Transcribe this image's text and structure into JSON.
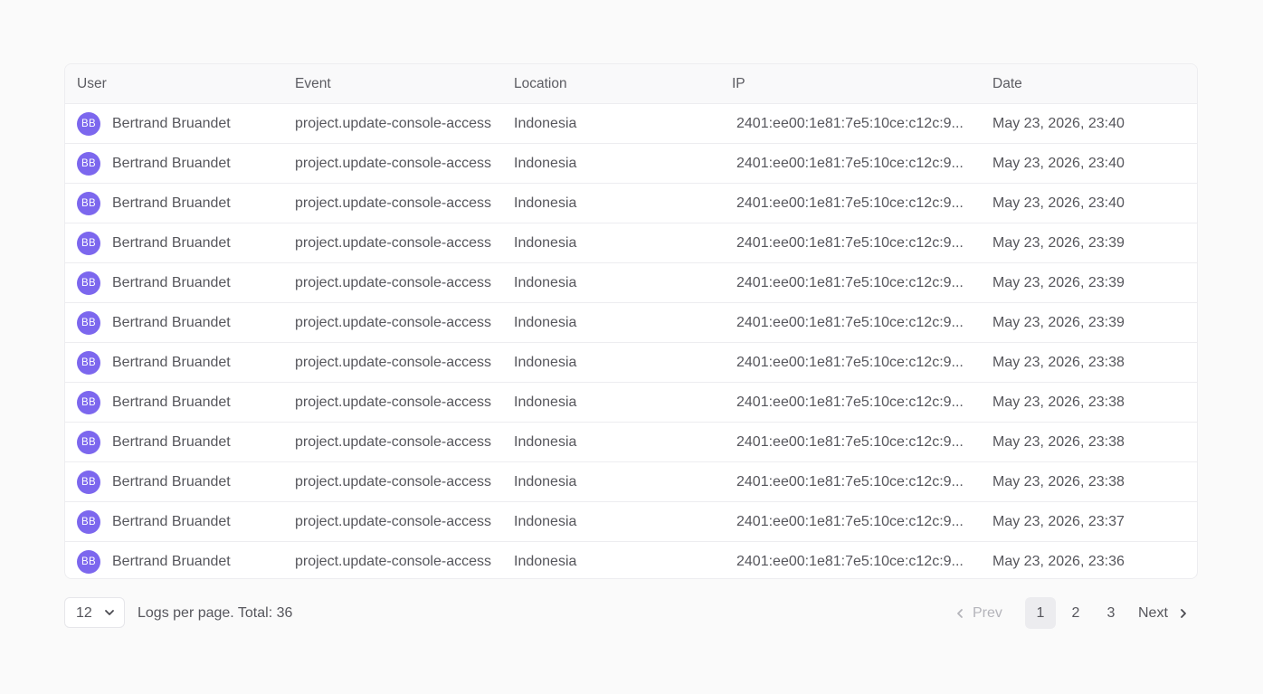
{
  "table": {
    "columns": {
      "user": "User",
      "event": "Event",
      "location": "Location",
      "ip": "IP",
      "date": "Date"
    },
    "rows": [
      {
        "initials": "BB",
        "user": "Bertrand Bruandet",
        "event": "project.update-console-access",
        "location": "Indonesia",
        "ip": "2401:ee00:1e81:7e5:10ce:c12c:9...",
        "date": "May 23, 2026, 23:40"
      },
      {
        "initials": "BB",
        "user": "Bertrand Bruandet",
        "event": "project.update-console-access",
        "location": "Indonesia",
        "ip": "2401:ee00:1e81:7e5:10ce:c12c:9...",
        "date": "May 23, 2026, 23:40"
      },
      {
        "initials": "BB",
        "user": "Bertrand Bruandet",
        "event": "project.update-console-access",
        "location": "Indonesia",
        "ip": "2401:ee00:1e81:7e5:10ce:c12c:9...",
        "date": "May 23, 2026, 23:40"
      },
      {
        "initials": "BB",
        "user": "Bertrand Bruandet",
        "event": "project.update-console-access",
        "location": "Indonesia",
        "ip": "2401:ee00:1e81:7e5:10ce:c12c:9...",
        "date": "May 23, 2026, 23:39"
      },
      {
        "initials": "BB",
        "user": "Bertrand Bruandet",
        "event": "project.update-console-access",
        "location": "Indonesia",
        "ip": "2401:ee00:1e81:7e5:10ce:c12c:9...",
        "date": "May 23, 2026, 23:39"
      },
      {
        "initials": "BB",
        "user": "Bertrand Bruandet",
        "event": "project.update-console-access",
        "location": "Indonesia",
        "ip": "2401:ee00:1e81:7e5:10ce:c12c:9...",
        "date": "May 23, 2026, 23:39"
      },
      {
        "initials": "BB",
        "user": "Bertrand Bruandet",
        "event": "project.update-console-access",
        "location": "Indonesia",
        "ip": "2401:ee00:1e81:7e5:10ce:c12c:9...",
        "date": "May 23, 2026, 23:38"
      },
      {
        "initials": "BB",
        "user": "Bertrand Bruandet",
        "event": "project.update-console-access",
        "location": "Indonesia",
        "ip": "2401:ee00:1e81:7e5:10ce:c12c:9...",
        "date": "May 23, 2026, 23:38"
      },
      {
        "initials": "BB",
        "user": "Bertrand Bruandet",
        "event": "project.update-console-access",
        "location": "Indonesia",
        "ip": "2401:ee00:1e81:7e5:10ce:c12c:9...",
        "date": "May 23, 2026, 23:38"
      },
      {
        "initials": "BB",
        "user": "Bertrand Bruandet",
        "event": "project.update-console-access",
        "location": "Indonesia",
        "ip": "2401:ee00:1e81:7e5:10ce:c12c:9...",
        "date": "May 23, 2026, 23:38"
      },
      {
        "initials": "BB",
        "user": "Bertrand Bruandet",
        "event": "project.update-console-access",
        "location": "Indonesia",
        "ip": "2401:ee00:1e81:7e5:10ce:c12c:9...",
        "date": "May 23, 2026, 23:37"
      },
      {
        "initials": "BB",
        "user": "Bertrand Bruandet",
        "event": "project.update-console-access",
        "location": "Indonesia",
        "ip": "2401:ee00:1e81:7e5:10ce:c12c:9...",
        "date": "May 23, 2026, 23:36"
      }
    ]
  },
  "footer": {
    "per_page_value": "12",
    "per_page_label": "Logs per page. Total: 36",
    "prev_label": "Prev",
    "next_label": "Next",
    "pages": [
      "1",
      "2",
      "3"
    ],
    "current_page": "1"
  },
  "colors": {
    "avatar": "#7c67ee",
    "background": "#fafafa",
    "active_page": "#ececef"
  },
  "icons": {
    "per_page": "chevron-down-icon",
    "prev": "chevron-left-icon",
    "next": "chevron-right-icon"
  }
}
